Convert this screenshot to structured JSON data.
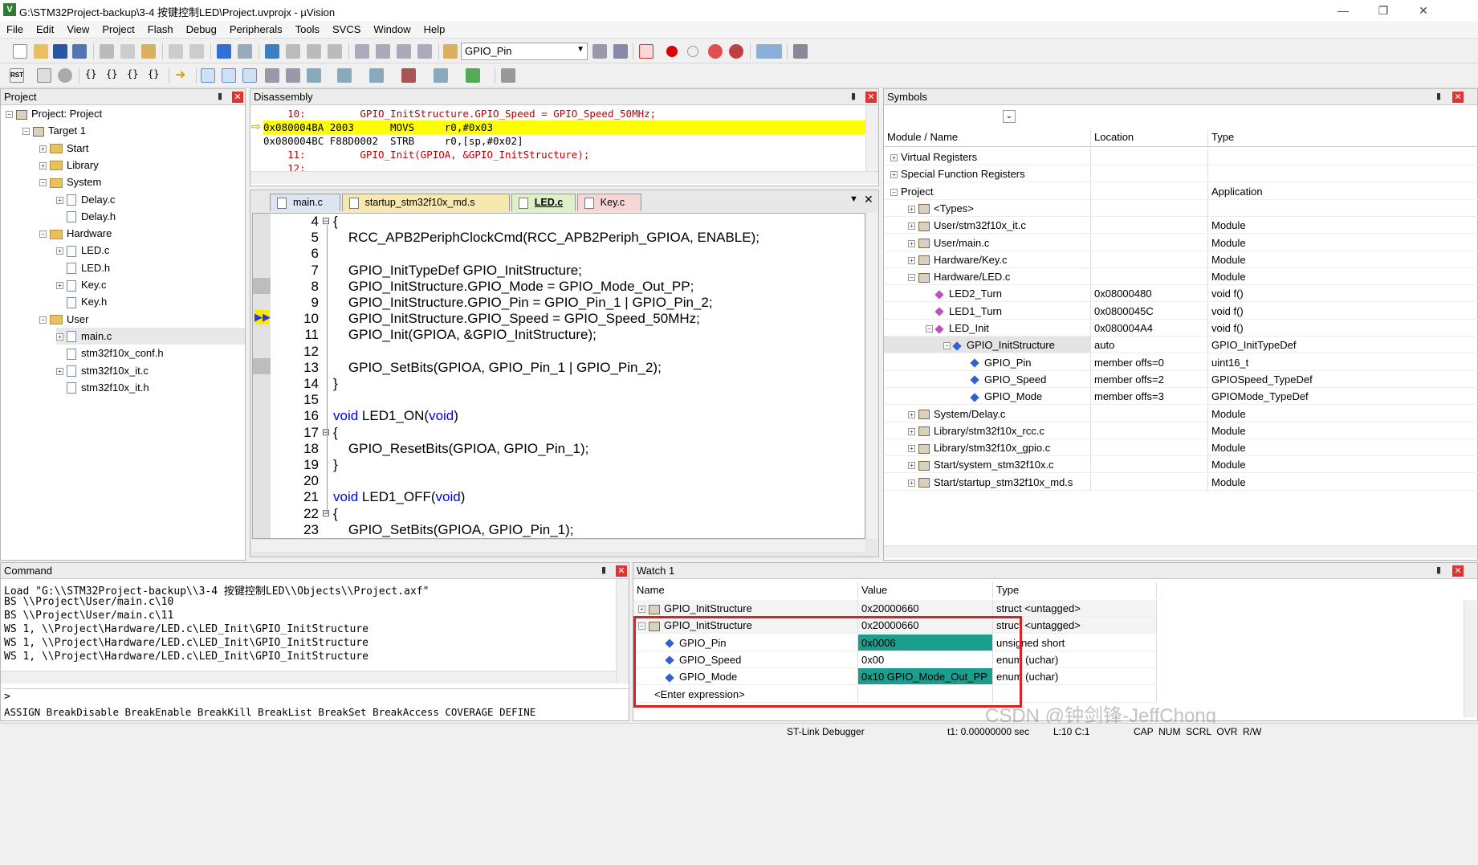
{
  "window": {
    "title": "G:\\STM32Project-backup\\3-4 按键控制LED\\Project.uvprojx - µVision",
    "app_icon": "V"
  },
  "menu": [
    "File",
    "Edit",
    "View",
    "Project",
    "Flash",
    "Debug",
    "Peripherals",
    "Tools",
    "SVCS",
    "Window",
    "Help"
  ],
  "toolbar": {
    "find_combo": "GPIO_Pin"
  },
  "project": {
    "title": "Project",
    "items": [
      {
        "label": "Project: Project",
        "indent": 0,
        "icon": "project-icon",
        "exp": "⊟"
      },
      {
        "label": "Target 1",
        "indent": 1,
        "icon": "target-icon",
        "exp": "⊟"
      },
      {
        "label": "Start",
        "indent": 2,
        "icon": "folder",
        "exp": "⊞"
      },
      {
        "label": "Library",
        "indent": 2,
        "icon": "folder",
        "exp": "⊞"
      },
      {
        "label": "System",
        "indent": 2,
        "icon": "folder",
        "exp": "⊟"
      },
      {
        "label": "Delay.c",
        "indent": 3,
        "icon": "file",
        "exp": "⊞"
      },
      {
        "label": "Delay.h",
        "indent": 3,
        "icon": "file",
        "exp": ""
      },
      {
        "label": "Hardware",
        "indent": 2,
        "icon": "folder",
        "exp": "⊟"
      },
      {
        "label": "LED.c",
        "indent": 3,
        "icon": "file",
        "exp": "⊞"
      },
      {
        "label": "LED.h",
        "indent": 3,
        "icon": "file",
        "exp": ""
      },
      {
        "label": "Key.c",
        "indent": 3,
        "icon": "file",
        "exp": "⊞"
      },
      {
        "label": "Key.h",
        "indent": 3,
        "icon": "file",
        "exp": ""
      },
      {
        "label": "User",
        "indent": 2,
        "icon": "folder",
        "exp": "⊟"
      },
      {
        "label": "main.c",
        "indent": 3,
        "icon": "file",
        "exp": "⊞",
        "selected": true
      },
      {
        "label": "stm32f10x_conf.h",
        "indent": 3,
        "icon": "file",
        "exp": ""
      },
      {
        "label": "stm32f10x_it.c",
        "indent": 3,
        "icon": "file",
        "exp": "⊞"
      },
      {
        "label": "stm32f10x_it.h",
        "indent": 3,
        "icon": "file",
        "exp": ""
      }
    ]
  },
  "disassembly": {
    "title": "Disassembly",
    "lines": [
      {
        "text": "    10:         GPIO_InitStructure.GPIO_Speed = GPIO_Speed_50MHz;",
        "kind": "src"
      },
      {
        "text": "0x080004BA 2003      MOVS     r0,#0x03",
        "kind": "current"
      },
      {
        "text": "0x080004BC F88D0002  STRB     r0,[sp,#0x02]",
        "kind": "asm"
      },
      {
        "text": "    11:         GPIO_Init(GPIOA, &GPIO_InitStructure);",
        "kind": "src"
      },
      {
        "text": "    12:",
        "kind": "src"
      }
    ]
  },
  "editor": {
    "tabs": [
      {
        "label": "main.c",
        "color": "#dde4f2",
        "active": false
      },
      {
        "label": "startup_stm32f10x_md.s",
        "color": "#f6e9b0",
        "active": false
      },
      {
        "label": "LED.c",
        "color": "#dff0c8",
        "active": true
      },
      {
        "label": "Key.c",
        "color": "#f7d6d6",
        "active": false
      }
    ],
    "lines": [
      {
        "n": "4",
        "fold": "⊟",
        "parts": [
          {
            "t": "{"
          }
        ]
      },
      {
        "n": "5",
        "parts": [
          {
            "t": "    RCC_APB2PeriphClockCmd(RCC_APB2Periph_GPIOA, ENABLE);"
          }
        ]
      },
      {
        "n": "6",
        "parts": [
          {
            "t": ""
          }
        ]
      },
      {
        "n": "7",
        "parts": [
          {
            "t": "    GPIO_InitTypeDef GPIO_InitStructure;"
          }
        ]
      },
      {
        "n": "8",
        "parts": [
          {
            "t": "    GPIO_InitStructure.GPIO_Mode = GPIO_Mode_Out_PP;"
          }
        ]
      },
      {
        "n": "9",
        "parts": [
          {
            "t": "    GPIO_InitStructure.GPIO_Pin = GPIO_Pin_1 | GPIO_Pin_2;"
          }
        ]
      },
      {
        "n": "10",
        "parts": [
          {
            "t": "    GPIO_InitStructure.GPIO_Speed = GPIO_Speed_50MHz;"
          }
        ]
      },
      {
        "n": "11",
        "parts": [
          {
            "t": "    GPIO_Init(GPIOA, &GPIO_InitStructure);"
          }
        ]
      },
      {
        "n": "12",
        "parts": [
          {
            "t": ""
          }
        ]
      },
      {
        "n": "13",
        "parts": [
          {
            "t": "    GPIO_SetBits(GPIOA, GPIO_Pin_1 | GPIO_Pin_2);"
          }
        ]
      },
      {
        "n": "14",
        "parts": [
          {
            "t": "}"
          }
        ]
      },
      {
        "n": "15",
        "parts": [
          {
            "t": ""
          }
        ]
      },
      {
        "n": "16",
        "parts": [
          {
            "t": "void",
            "kw": true
          },
          {
            "t": " LED1_ON("
          },
          {
            "t": "void",
            "kw": true
          },
          {
            "t": ")"
          }
        ]
      },
      {
        "n": "17",
        "fold": "⊟",
        "parts": [
          {
            "t": "{"
          }
        ]
      },
      {
        "n": "18",
        "parts": [
          {
            "t": "    GPIO_ResetBits(GPIOA, GPIO_Pin_1);"
          }
        ]
      },
      {
        "n": "19",
        "parts": [
          {
            "t": "}"
          }
        ]
      },
      {
        "n": "20",
        "parts": [
          {
            "t": ""
          }
        ]
      },
      {
        "n": "21",
        "parts": [
          {
            "t": "void",
            "kw": true
          },
          {
            "t": " LED1_OFF("
          },
          {
            "t": "void",
            "kw": true
          },
          {
            "t": ")"
          }
        ]
      },
      {
        "n": "22",
        "fold": "⊟",
        "parts": [
          {
            "t": "{"
          }
        ]
      },
      {
        "n": "23",
        "parts": [
          {
            "t": "    GPIO_SetBits(GPIOA, GPIO_Pin_1);"
          }
        ]
      }
    ]
  },
  "symbols": {
    "title": "Symbols",
    "headers": [
      "Module / Name",
      "Location",
      "Type"
    ],
    "rows": [
      {
        "name": "Virtual Registers",
        "indent": 0,
        "exp": "⊞",
        "icon": "",
        "loc": "",
        "type": ""
      },
      {
        "name": "Special Function Registers",
        "indent": 0,
        "exp": "⊞",
        "icon": "",
        "loc": "",
        "type": ""
      },
      {
        "name": "Project",
        "indent": 0,
        "exp": "⊟",
        "icon": "",
        "loc": "",
        "type": "Application"
      },
      {
        "name": "<Types>",
        "indent": 1,
        "exp": "⊞",
        "icon": "cube",
        "loc": "",
        "type": ""
      },
      {
        "name": "User/stm32f10x_it.c",
        "indent": 1,
        "exp": "⊞",
        "icon": "cube",
        "loc": "",
        "type": "Module"
      },
      {
        "name": "User/main.c",
        "indent": 1,
        "exp": "⊞",
        "icon": "cube",
        "loc": "",
        "type": "Module"
      },
      {
        "name": "Hardware/Key.c",
        "indent": 1,
        "exp": "⊞",
        "icon": "cube",
        "loc": "",
        "type": "Module"
      },
      {
        "name": "Hardware/LED.c",
        "indent": 1,
        "exp": "⊟",
        "icon": "cube",
        "loc": "",
        "type": "Module"
      },
      {
        "name": "LED2_Turn",
        "indent": 2,
        "exp": "",
        "icon": "pink",
        "loc": "0x08000480",
        "type": "void f()"
      },
      {
        "name": "LED1_Turn",
        "indent": 2,
        "exp": "",
        "icon": "pink",
        "loc": "0x0800045C",
        "type": "void f()"
      },
      {
        "name": "LED_Init",
        "indent": 2,
        "exp": "⊟",
        "icon": "pink",
        "loc": "0x080004A4",
        "type": "void f()"
      },
      {
        "name": "GPIO_InitStructure",
        "indent": 3,
        "exp": "⊟",
        "icon": "blue",
        "loc": "auto",
        "type": "GPIO_InitTypeDef",
        "sel": true
      },
      {
        "name": "GPIO_Pin",
        "indent": 4,
        "exp": "",
        "icon": "blue",
        "loc": "member offs=0",
        "type": "uint16_t"
      },
      {
        "name": "GPIO_Speed",
        "indent": 4,
        "exp": "",
        "icon": "blue",
        "loc": "member offs=2",
        "type": "GPIOSpeed_TypeDef"
      },
      {
        "name": "GPIO_Mode",
        "indent": 4,
        "exp": "",
        "icon": "blue",
        "loc": "member offs=3",
        "type": "GPIOMode_TypeDef"
      },
      {
        "name": "System/Delay.c",
        "indent": 1,
        "exp": "⊞",
        "icon": "cube",
        "loc": "",
        "type": "Module"
      },
      {
        "name": "Library/stm32f10x_rcc.c",
        "indent": 1,
        "exp": "⊞",
        "icon": "cube",
        "loc": "",
        "type": "Module"
      },
      {
        "name": "Library/stm32f10x_gpio.c",
        "indent": 1,
        "exp": "⊞",
        "icon": "cube",
        "loc": "",
        "type": "Module"
      },
      {
        "name": "Start/system_stm32f10x.c",
        "indent": 1,
        "exp": "⊞",
        "icon": "cube",
        "loc": "",
        "type": "Module"
      },
      {
        "name": "Start/startup_stm32f10x_md.s",
        "indent": 1,
        "exp": "⊞",
        "icon": "cube",
        "loc": "",
        "type": "Module"
      }
    ]
  },
  "command": {
    "title": "Command",
    "lines": [
      "Load \"G:\\\\STM32Project-backup\\\\3-4 按键控制LED\\\\Objects\\\\Project.axf\"",
      "BS \\\\Project\\User/main.c\\10",
      "BS \\\\Project\\User/main.c\\11",
      "WS 1, \\\\Project\\Hardware/LED.c\\LED_Init\\GPIO_InitStructure",
      "WS 1, \\\\Project\\Hardware/LED.c\\LED_Init\\GPIO_InitStructure",
      "WS 1, \\\\Project\\Hardware/LED.c\\LED_Init\\GPIO_InitStructure"
    ],
    "prompt": ">",
    "hint": "ASSIGN BreakDisable BreakEnable BreakKill BreakList BreakSet BreakAccess COVERAGE DEFINE"
  },
  "watch": {
    "title": "Watch 1",
    "headers": [
      "Name",
      "Value",
      "Type"
    ],
    "rows": [
      {
        "name": "GPIO_InitStructure",
        "indent": 0,
        "exp": "⊞",
        "icon": "cube",
        "value": "0x20000660",
        "type": "struct <untagged>",
        "hl": false
      },
      {
        "name": "GPIO_InitStructure",
        "indent": 0,
        "exp": "⊟",
        "icon": "cube",
        "value": "0x20000660",
        "type": "struct <untagged>",
        "hl": false
      },
      {
        "name": "GPIO_Pin",
        "indent": 1,
        "exp": "",
        "icon": "blue",
        "value": "0x0006",
        "type": "unsigned short",
        "hl": true
      },
      {
        "name": "GPIO_Speed",
        "indent": 1,
        "exp": "",
        "icon": "blue",
        "value": "0x00",
        "type": "enum (uchar)",
        "hl": false
      },
      {
        "name": "GPIO_Mode",
        "indent": 1,
        "exp": "",
        "icon": "blue",
        "value": "0x10 GPIO_Mode_Out_PP",
        "type": "enum (uchar)",
        "hl": true
      },
      {
        "name": "<Enter expression>",
        "indent": 0,
        "exp": "",
        "icon": "",
        "value": "",
        "type": "",
        "hl": false
      }
    ]
  },
  "statusbar": {
    "debugger": "ST-Link Debugger",
    "time": "t1: 0.00000000 sec",
    "pos": "L:10 C:1",
    "flags": "CAP  NUM  SCRL  OVR  R/W"
  },
  "watermark": "CSDN @钟剑锋-JeffChong",
  "colors": {
    "current_line": "#ffff00",
    "watch_highlight": "#1a9e8e",
    "red_box": "#e02020",
    "keyword": "#0000ff"
  }
}
